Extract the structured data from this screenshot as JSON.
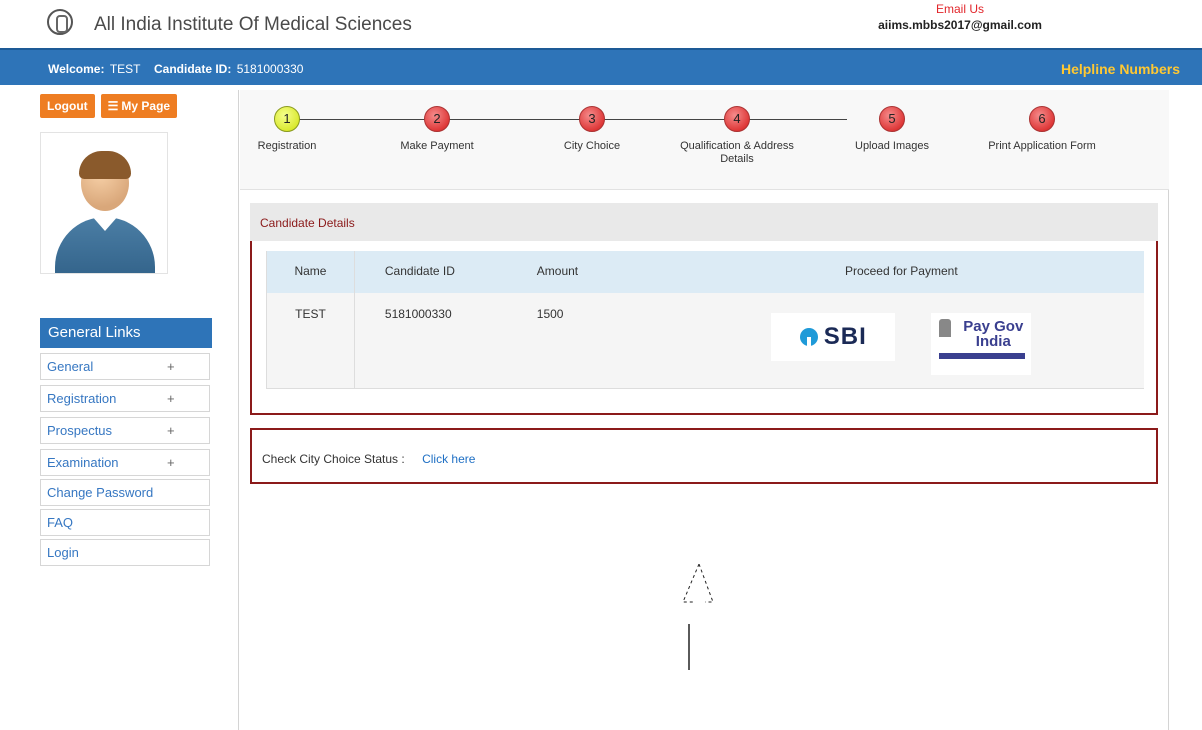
{
  "header": {
    "title": "All India Institute Of Medical Sciences",
    "email_label": "Email Us",
    "email_value": "aiims.mbbs2017@gmail.com"
  },
  "bluebar": {
    "welcome_label": "Welcome:",
    "welcome_name": "TEST",
    "candidate_label": "Candidate ID:",
    "candidate_id": "5181000330",
    "helpline": "Helpline Numbers"
  },
  "sidebar": {
    "logout": "Logout",
    "mypage": "My Page",
    "links_header": "General Links",
    "items": [
      {
        "label": "General",
        "plus": "+"
      },
      {
        "label": "Registration",
        "plus": "+"
      },
      {
        "label": "Prospectus",
        "plus": "+"
      },
      {
        "label": "Examination",
        "plus": "+"
      }
    ],
    "single_items": [
      "Change Password",
      "FAQ",
      "Login"
    ]
  },
  "steps": [
    {
      "num": "1",
      "label": "Registration"
    },
    {
      "num": "2",
      "label": "Make Payment"
    },
    {
      "num": "3",
      "label": "City Choice"
    },
    {
      "num": "4",
      "label": "Qualification & Address Details"
    },
    {
      "num": "5",
      "label": "Upload Images"
    },
    {
      "num": "6",
      "label": "Print Application Form"
    }
  ],
  "candidate_details": {
    "title": "Candidate Details",
    "columns": [
      "Name",
      "Candidate ID",
      "Amount",
      "Proceed for Payment"
    ],
    "row": {
      "name": "TEST",
      "candidate_id": "5181000330",
      "amount": "1500"
    },
    "sbi_label": "SBI",
    "paygov_label": "Pay Gov India"
  },
  "city_choice": {
    "label": "Check City Choice Status :",
    "link": "Click here"
  },
  "colors": {
    "brand_blue": "#2e74b8",
    "accent_orange": "#ee7d22",
    "helpline_yellow": "#ffc832",
    "border_maroon": "#8b1a1a"
  }
}
